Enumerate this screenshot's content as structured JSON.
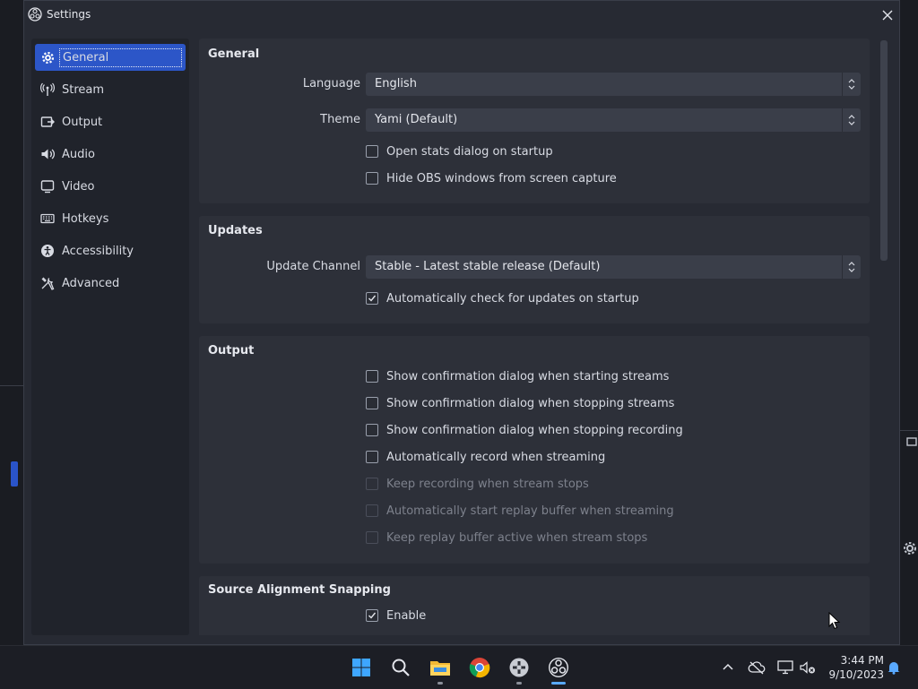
{
  "window": {
    "title": "Settings"
  },
  "sidebar": {
    "items": [
      {
        "label": "General",
        "icon": "gear-icon",
        "active": true
      },
      {
        "label": "Stream",
        "icon": "broadcast-icon"
      },
      {
        "label": "Output",
        "icon": "output-icon"
      },
      {
        "label": "Audio",
        "icon": "speaker-icon"
      },
      {
        "label": "Video",
        "icon": "monitor-icon"
      },
      {
        "label": "Hotkeys",
        "icon": "keyboard-icon"
      },
      {
        "label": "Accessibility",
        "icon": "accessibility-icon"
      },
      {
        "label": "Advanced",
        "icon": "tools-icon"
      }
    ]
  },
  "general": {
    "title": "General",
    "language_label": "Language",
    "language_value": "English",
    "theme_label": "Theme",
    "theme_value": "Yami (Default)",
    "open_stats": {
      "label": "Open stats dialog on startup",
      "checked": false
    },
    "hide_obs": {
      "label": "Hide OBS windows from screen capture",
      "checked": false
    }
  },
  "updates": {
    "title": "Updates",
    "channel_label": "Update Channel",
    "channel_value": "Stable - Latest stable release (Default)",
    "auto_check": {
      "label": "Automatically check for updates on startup",
      "checked": true
    }
  },
  "output": {
    "title": "Output",
    "options": [
      {
        "label": "Show confirmation dialog when starting streams",
        "checked": false,
        "disabled": false
      },
      {
        "label": "Show confirmation dialog when stopping streams",
        "checked": false,
        "disabled": false
      },
      {
        "label": "Show confirmation dialog when stopping recording",
        "checked": false,
        "disabled": false
      },
      {
        "label": "Automatically record when streaming",
        "checked": false,
        "disabled": false
      },
      {
        "label": "Keep recording when stream stops",
        "checked": false,
        "disabled": true
      },
      {
        "label": "Automatically start replay buffer when streaming",
        "checked": false,
        "disabled": true
      },
      {
        "label": "Keep replay buffer active when stream stops",
        "checked": false,
        "disabled": true
      }
    ]
  },
  "snapping": {
    "title": "Source Alignment Snapping",
    "enable": {
      "label": "Enable",
      "checked": true
    }
  },
  "taskbar": {
    "time": "3:44 PM",
    "date": "9/10/2023"
  },
  "colors": {
    "accent": "#2c56c8",
    "panel": "#2d3039",
    "background": "#272a33"
  }
}
